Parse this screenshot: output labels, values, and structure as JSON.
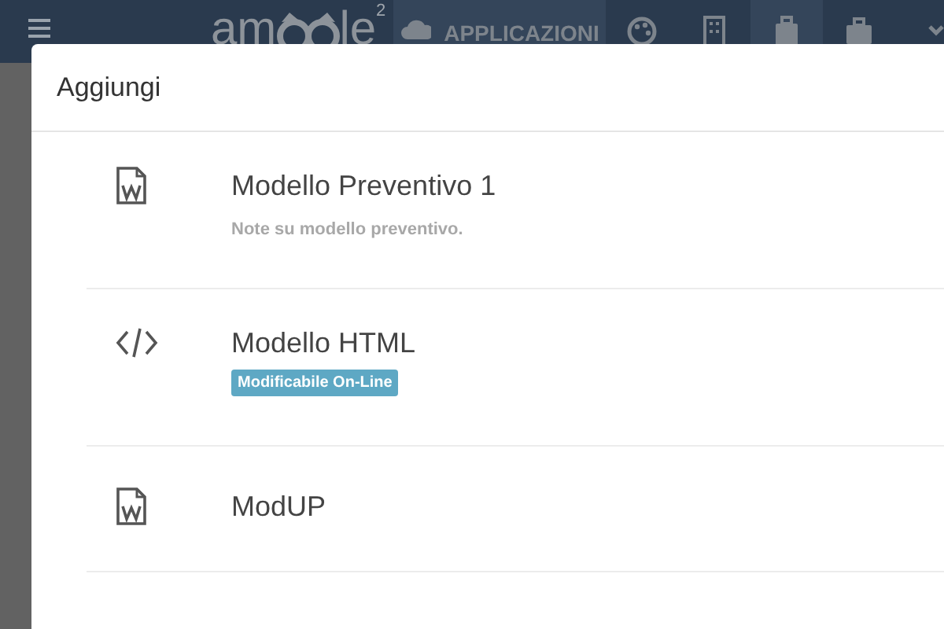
{
  "app_bar": {
    "logo": {
      "before": "am",
      "after": "le",
      "sup": "2"
    },
    "nav": [
      {
        "kind": "cloud",
        "label": "APPLICAZIONI",
        "selected": true
      },
      {
        "kind": "palette",
        "selected": false
      },
      {
        "kind": "building",
        "selected": false
      },
      {
        "kind": "suitcase",
        "selected": true
      },
      {
        "kind": "briefcase",
        "selected": false
      },
      {
        "kind": "chevron"
      }
    ]
  },
  "dialog": {
    "title": "Aggiungi",
    "items": [
      {
        "kind": "word",
        "title": "Modello Preventivo 1",
        "note": "Note su modello preventivo."
      },
      {
        "kind": "code",
        "title": "Modello HTML",
        "badge": "Modificabile On-Line"
      },
      {
        "kind": "word",
        "title": "ModUP"
      }
    ]
  }
}
